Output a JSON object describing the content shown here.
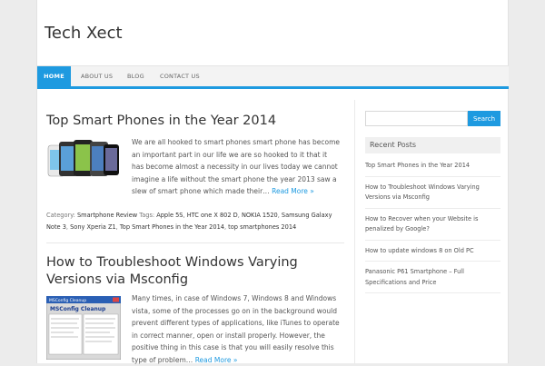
{
  "site": {
    "title": "Tech Xect"
  },
  "nav": {
    "items": [
      {
        "label": "HOME",
        "active": true
      },
      {
        "label": "ABOUT US",
        "active": false
      },
      {
        "label": "BLOG",
        "active": false
      },
      {
        "label": "CONTACT US",
        "active": false
      }
    ]
  },
  "posts": [
    {
      "title": "Top Smart Phones in the Year 2014",
      "excerpt": "We are all hooked to smart phones smart phone has become an important part in our life we are so hooked to it that it has become almost a necessity in our lives today we cannot imagine a life without the smart phone the year 2013 saw a slew of smart phone which made their…",
      "more": "Read More »",
      "category_label": "Category:",
      "category": "Smartphone Review",
      "tags_label": "Tags:",
      "tags": [
        "Apple 5S",
        "HTC one X 802 D",
        "NOKIA 1520",
        "Samsung Galaxy Note 3",
        "Sony Xperia Z1",
        "Top Smart Phones in the Year 2014",
        "top smartphones 2014"
      ]
    },
    {
      "title": "How to Troubleshoot Windows Varying Versions via Msconfig",
      "excerpt": "Many times, in case of Windows 7, Windows 8 and Windows vista, some of the processes go on in the background would prevent different types of applications, like iTunes to operate in correct manner, open or install properly. However, the positive thing in this case is that you will easily resolve this type of problem…",
      "more": "Read More »",
      "thumb_window_title": "MSConfig Cleanup",
      "thumb_heading": "MSConfig Cleanup"
    }
  ],
  "sidebar": {
    "search_button": "Search",
    "search_value": "",
    "recent_title": "Recent Posts",
    "recent_posts": [
      "Top Smart Phones in the Year 2014",
      "How to Troubleshoot Windows Varying Versions via Msconfig",
      "How to Recover when your Website is penalized by Google?",
      "How to update windows 8 on Old PC",
      "Panasonic P61 Smartphone – Full Specifications and Price"
    ]
  },
  "colors": {
    "accent": "#1e9ae0",
    "background": "#ececec"
  }
}
